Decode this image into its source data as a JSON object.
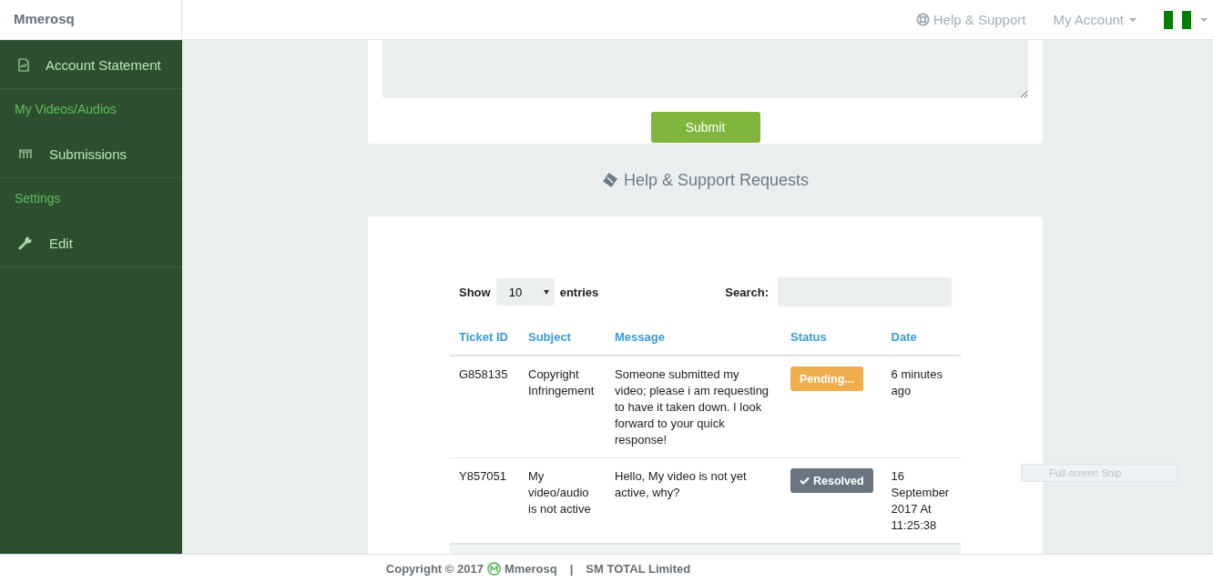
{
  "brand": "Mmerosq",
  "topnav": {
    "help": "Help & Support",
    "account": "My Account"
  },
  "sidebar": {
    "items": [
      {
        "kind": "link",
        "label": "Account Statement"
      },
      {
        "kind": "heading",
        "label": "My Videos/Audios"
      },
      {
        "kind": "link",
        "label": "Submissions"
      },
      {
        "kind": "heading",
        "label": "Settings"
      },
      {
        "kind": "link",
        "label": "Edit"
      }
    ]
  },
  "form": {
    "submit": "Submit"
  },
  "section_title": "Help & Support Requests",
  "table": {
    "show_label": "Show",
    "page_size": "10",
    "entries_label": "entries",
    "search_label": "Search:",
    "columns": [
      "Ticket ID",
      "Subject",
      "Message",
      "Status",
      "Date"
    ],
    "rows": [
      {
        "ticket_id": "G858135",
        "subject": "Copyright Infringement",
        "message": "Someone submitted my video; please i am requesting to have it taken down. I look forward to your quick response!",
        "status": {
          "kind": "pending",
          "label": "Pending..."
        },
        "date": "6 minutes ago"
      },
      {
        "ticket_id": "Y857051",
        "subject": "My video/audio is not active",
        "message": "Hello, My video is not yet active, why?",
        "status": {
          "kind": "resolved",
          "label": "Resolved"
        },
        "date": "16 September 2017 At 11:25:38"
      }
    ]
  },
  "snip_tooltip": "Full-screen Snip",
  "footer": {
    "copyright": "Copyright © 2017",
    "brand": "Mmerosq",
    "separator": "|",
    "company": "SM TOTAL Limited"
  }
}
